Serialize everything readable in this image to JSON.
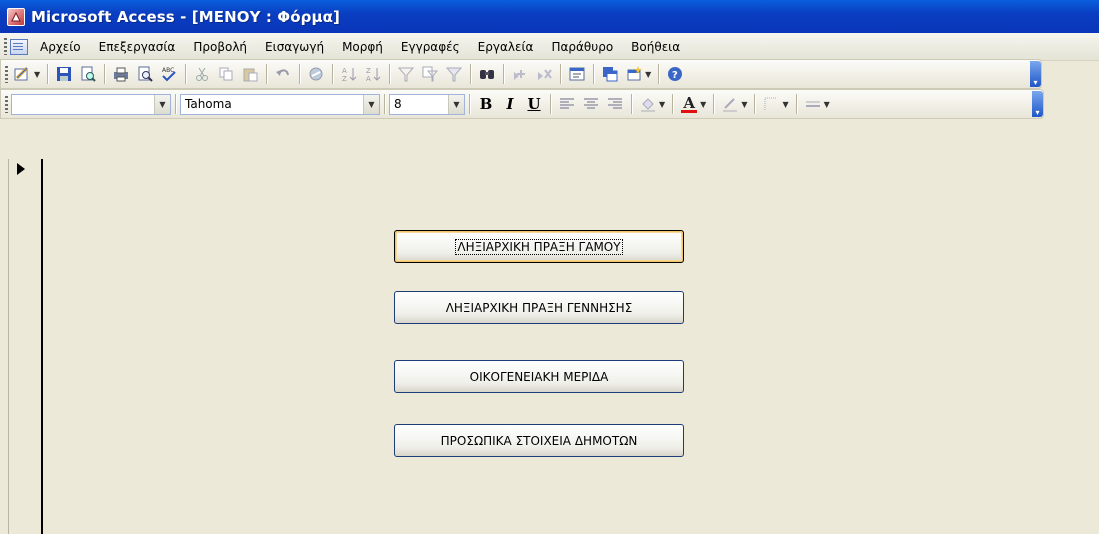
{
  "window": {
    "title": "Microsoft Access - [ΜΕΝΟΥ : Φόρμα]"
  },
  "menu": {
    "items": [
      "Αρχείο",
      "Επεξεργασία",
      "Προβολή",
      "Εισαγωγή",
      "Μορφή",
      "Εγγραφές",
      "Εργαλεία",
      "Παράθυρο",
      "Βοήθεια"
    ]
  },
  "format_toolbar": {
    "object_combo": "",
    "font_name": "Tahoma",
    "font_size": "8",
    "bold_label": "B",
    "italic_label": "I",
    "underline_label": "U",
    "font_color_label": "A"
  },
  "form": {
    "buttons": [
      "ΛΗΞΙΑΡΧΙΚΗ ΠΡΑΞΗ ΓΑΜΟΥ",
      "ΛΗΞΙΑΡΧΙΚΗ ΠΡΑΞΗ ΓΕΝΝΗΣΗΣ",
      "ΟΙΚΟΓΕΝΕΙΑΚΗ ΜΕΡΙΔΑ",
      "ΠΡΟΣΩΠΙΚΑ ΣΤΟΙΧΕΙΑ ΔΗΜΟΤΩΝ"
    ]
  },
  "icons": {
    "standard_toolbar": [
      "view-icon",
      "save-icon",
      "file-search-icon",
      "print-icon",
      "print-preview-icon",
      "spelling-icon",
      "cut-icon",
      "copy-icon",
      "paste-icon",
      "undo-icon",
      "hyperlink-icon",
      "sort-ascending-icon",
      "sort-descending-icon",
      "filter-by-selection-icon",
      "filter-by-form-icon",
      "apply-filter-icon",
      "find-icon",
      "new-record-icon",
      "delete-record-icon",
      "properties-icon",
      "database-window-icon",
      "new-object-icon",
      "help-icon"
    ],
    "formatting_toolbar": [
      "align-left-icon",
      "align-center-icon",
      "align-right-icon",
      "fill-color-icon",
      "font-color-icon",
      "line-color-icon",
      "line-width-icon",
      "special-effect-icon"
    ]
  },
  "colors": {
    "titlebar": "#0a3ec2",
    "background": "#ece9d8",
    "focus": "#f2c46a"
  }
}
